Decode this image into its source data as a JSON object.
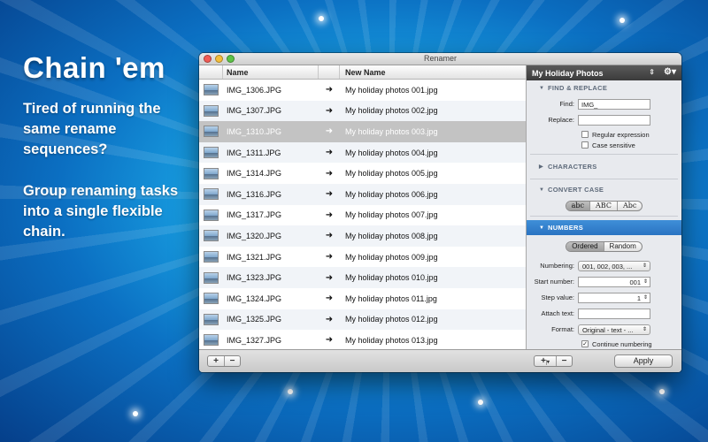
{
  "promo": {
    "headline": "Chain 'em",
    "para1": "Tired of running the same rename sequences?",
    "para2": "Group renaming tasks into a single flexible chain."
  },
  "window": {
    "title": "Renamer"
  },
  "list": {
    "col_name": "Name",
    "col_new_name": "New Name",
    "arrow_glyph": "➜",
    "rows": [
      {
        "name": "IMG_1306.JPG",
        "new": "My holiday photos 001.jpg"
      },
      {
        "name": "IMG_1307.JPG",
        "new": "My holiday photos 002.jpg"
      },
      {
        "name": "IMG_1310.JPG",
        "new": "My holiday photos 003.jpg"
      },
      {
        "name": "IMG_1311.JPG",
        "new": "My holiday photos 004.jpg"
      },
      {
        "name": "IMG_1314.JPG",
        "new": "My holiday photos 005.jpg"
      },
      {
        "name": "IMG_1316.JPG",
        "new": "My holiday photos 006.jpg"
      },
      {
        "name": "IMG_1317.JPG",
        "new": "My holiday photos 007.jpg"
      },
      {
        "name": "IMG_1320.JPG",
        "new": "My holiday photos 008.jpg"
      },
      {
        "name": "IMG_1321.JPG",
        "new": "My holiday photos 009.jpg"
      },
      {
        "name": "IMG_1323.JPG",
        "new": "My holiday photos 010.jpg"
      },
      {
        "name": "IMG_1324.JPG",
        "new": "My holiday photos 011.jpg"
      },
      {
        "name": "IMG_1325.JPG",
        "new": "My holiday photos 012.jpg"
      },
      {
        "name": "IMG_1327.JPG",
        "new": "My holiday photos 013.jpg"
      }
    ],
    "selected_index": 2
  },
  "panel": {
    "preset": "My Holiday Photos",
    "find_replace": {
      "title": "FIND & REPLACE",
      "find_label": "Find:",
      "find_value": "IMG_",
      "replace_label": "Replace:",
      "replace_value": "",
      "regex_label": "Regular expression",
      "case_label": "Case sensitive"
    },
    "characters_title": "CHARACTERS",
    "convert_case": {
      "title": "CONVERT CASE",
      "options": [
        "abc",
        "ABC",
        "Abc"
      ]
    },
    "numbers": {
      "title": "NUMBERS",
      "modes": [
        "Ordered",
        "Random"
      ],
      "numbering_label": "Numbering:",
      "numbering_value": "001, 002, 003, ...",
      "start_label": "Start number:",
      "start_value": "001",
      "step_label": "Step value:",
      "step_value": "1",
      "attach_label": "Attach text:",
      "attach_value": "",
      "format_label": "Format:",
      "format_value": "Original - text - ...",
      "continue_label": "Continue numbering"
    }
  },
  "bottombar": {
    "add_glyph": "+",
    "remove_glyph": "−",
    "apply_label": "Apply"
  }
}
